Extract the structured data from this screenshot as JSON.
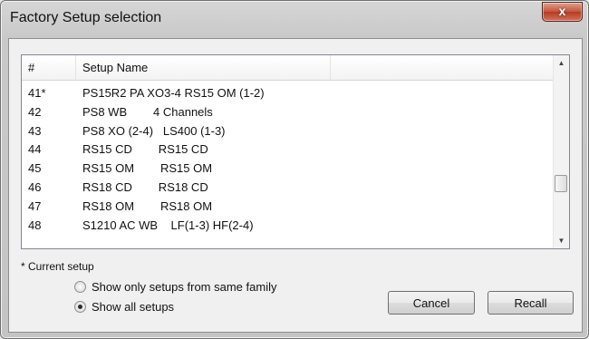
{
  "window": {
    "title": "Factory Setup selection",
    "close_glyph": "x"
  },
  "list": {
    "columns": [
      "#",
      "Setup Name",
      ""
    ],
    "rows": [
      {
        "num": "41*",
        "name": "PS15R2 PA XO3-4 RS15 OM (1-2)"
      },
      {
        "num": "42",
        "name": "PS8 WB        4 Channels"
      },
      {
        "num": "43",
        "name": "PS8 XO (2-4)   LS400 (1-3)"
      },
      {
        "num": "44",
        "name": "RS15 CD        RS15 CD"
      },
      {
        "num": "45",
        "name": "RS15 OM        RS15 OM"
      },
      {
        "num": "46",
        "name": "RS18 CD        RS18 CD"
      },
      {
        "num": "47",
        "name": "RS18 OM        RS18 OM"
      },
      {
        "num": "48",
        "name": "S1210 AC WB    LF(1-3) HF(2-4)"
      }
    ]
  },
  "note": "* Current setup",
  "options": [
    {
      "label": "Show only setups from same family",
      "checked": false
    },
    {
      "label": "Show all setups",
      "checked": true
    }
  ],
  "buttons": {
    "cancel": "Cancel",
    "recall": "Recall"
  },
  "icons": {
    "scroll_up": "chevron-up-icon",
    "scroll_down": "chevron-down-icon"
  }
}
